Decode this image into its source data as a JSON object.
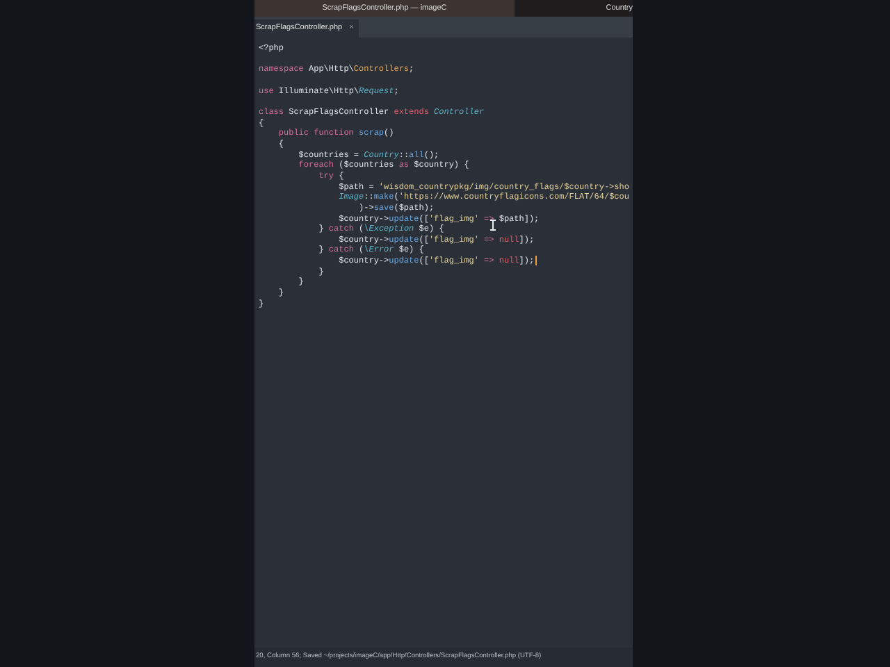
{
  "window": {
    "title": "ScrapFlagsController.php — imageC",
    "side_title": "Country"
  },
  "tabs": [
    {
      "label": "ScrapFlagsController.php",
      "close": "×",
      "selected": true
    }
  ],
  "code": [
    {
      "kind": "code",
      "tokens": [
        {
          "kind": "plain",
          "text": "<?php"
        }
      ]
    },
    {
      "kind": "blank"
    },
    {
      "kind": "code",
      "tokens": [
        {
          "kind": "keyword",
          "text": "namespace"
        },
        {
          "kind": "plain",
          "text": " App\\Http\\"
        },
        {
          "kind": "ns",
          "text": "Controllers"
        },
        {
          "kind": "plain",
          "text": ";"
        }
      ]
    },
    {
      "kind": "blank"
    },
    {
      "kind": "code",
      "tokens": [
        {
          "kind": "keyword",
          "text": "use"
        },
        {
          "kind": "plain",
          "text": " Illuminate\\Http\\"
        },
        {
          "kind": "type",
          "text": "Request"
        },
        {
          "kind": "plain",
          "text": ";"
        }
      ]
    },
    {
      "kind": "blank"
    },
    {
      "kind": "code",
      "tokens": [
        {
          "kind": "keyword",
          "text": "class"
        },
        {
          "kind": "plain",
          "text": " ScrapFlagsController "
        },
        {
          "kind": "const",
          "text": "extends"
        },
        {
          "kind": "type",
          "text": " Controller"
        }
      ]
    },
    {
      "kind": "code",
      "tokens": [
        {
          "kind": "plain",
          "text": "{"
        }
      ]
    },
    {
      "kind": "code",
      "tokens": [
        {
          "kind": "keyword",
          "text": "    public function"
        },
        {
          "kind": "func",
          "text": " scrap"
        },
        {
          "kind": "plain",
          "text": "()"
        }
      ]
    },
    {
      "kind": "code",
      "tokens": [
        {
          "kind": "plain",
          "text": "    {"
        }
      ]
    },
    {
      "kind": "code",
      "tokens": [
        {
          "kind": "plain",
          "text": "        $countries = "
        },
        {
          "kind": "type",
          "text": "Country"
        },
        {
          "kind": "plain",
          "text": "::"
        },
        {
          "kind": "func",
          "text": "all"
        },
        {
          "kind": "plain",
          "text": "();"
        }
      ]
    },
    {
      "kind": "code",
      "tokens": [
        {
          "kind": "keyword",
          "text": "        foreach"
        },
        {
          "kind": "plain",
          "text": " ($countries "
        },
        {
          "kind": "keyword",
          "text": "as"
        },
        {
          "kind": "plain",
          "text": " $country) {"
        }
      ]
    },
    {
      "kind": "code",
      "tokens": [
        {
          "kind": "keyword",
          "text": "            try"
        },
        {
          "kind": "plain",
          "text": " {"
        }
      ]
    },
    {
      "kind": "code",
      "tokens": [
        {
          "kind": "plain",
          "text": "                $path = "
        },
        {
          "kind": "string",
          "text": "'wisdom_countrypkg/img/country_flags/$country->sho"
        }
      ]
    },
    {
      "kind": "code",
      "tokens": [
        {
          "kind": "type",
          "text": "                Image"
        },
        {
          "kind": "plain",
          "text": "::"
        },
        {
          "kind": "func",
          "text": "make"
        },
        {
          "kind": "plain",
          "text": "("
        },
        {
          "kind": "string",
          "text": "'https://www.countryflagicons.com/FLAT/64/$cou"
        }
      ]
    },
    {
      "kind": "code",
      "tokens": [
        {
          "kind": "plain",
          "text": "                    )->"
        },
        {
          "kind": "func",
          "text": "save"
        },
        {
          "kind": "plain",
          "text": "($path);"
        }
      ]
    },
    {
      "kind": "code",
      "tokens": [
        {
          "kind": "plain",
          "text": "                $country->"
        },
        {
          "kind": "func",
          "text": "update"
        },
        {
          "kind": "plain",
          "text": "(["
        },
        {
          "kind": "string",
          "text": "'flag_img' "
        },
        {
          "kind": "keyword",
          "text": "=>"
        },
        {
          "kind": "plain",
          "text": " $path]);"
        }
      ]
    },
    {
      "kind": "code",
      "tokens": [
        {
          "kind": "plain",
          "text": "            } "
        },
        {
          "kind": "keyword",
          "text": "catch"
        },
        {
          "kind": "plain",
          "text": " ("
        },
        {
          "kind": "type",
          "text": "\\Exception"
        },
        {
          "kind": "plain",
          "text": " $e) {"
        }
      ]
    },
    {
      "kind": "code",
      "tokens": [
        {
          "kind": "plain",
          "text": "                $country->"
        },
        {
          "kind": "func",
          "text": "update"
        },
        {
          "kind": "plain",
          "text": "(["
        },
        {
          "kind": "string",
          "text": "'flag_img' "
        },
        {
          "kind": "keyword",
          "text": "=> "
        },
        {
          "kind": "const",
          "text": "null"
        },
        {
          "kind": "plain",
          "text": "]);"
        }
      ]
    },
    {
      "kind": "code",
      "tokens": [
        {
          "kind": "plain",
          "text": "            } "
        },
        {
          "kind": "keyword",
          "text": "catch"
        },
        {
          "kind": "plain",
          "text": " ("
        },
        {
          "kind": "type",
          "text": "\\Error"
        },
        {
          "kind": "plain",
          "text": " $e) {"
        }
      ]
    },
    {
      "kind": "code",
      "tokens": [
        {
          "kind": "plain",
          "text": "                $country->"
        },
        {
          "kind": "func",
          "text": "update"
        },
        {
          "kind": "plain",
          "text": "(["
        },
        {
          "kind": "string",
          "text": "'flag_img' "
        },
        {
          "kind": "keyword",
          "text": "=> "
        },
        {
          "kind": "const",
          "text": "null"
        },
        {
          "kind": "plain",
          "text": "]);"
        }
      ],
      "caret": true
    },
    {
      "kind": "code",
      "tokens": [
        {
          "kind": "plain",
          "text": "            }"
        }
      ]
    },
    {
      "kind": "code",
      "tokens": [
        {
          "kind": "plain",
          "text": "        }"
        }
      ]
    },
    {
      "kind": "code",
      "tokens": [
        {
          "kind": "plain",
          "text": "    }"
        }
      ]
    },
    {
      "kind": "code",
      "tokens": [
        {
          "kind": "plain",
          "text": "}"
        }
      ]
    }
  ],
  "status_bar": "20, Column 56; Saved ~/projects/imageC/app/Http/Controllers/ScrapFlagsController.php (UTF-8)"
}
